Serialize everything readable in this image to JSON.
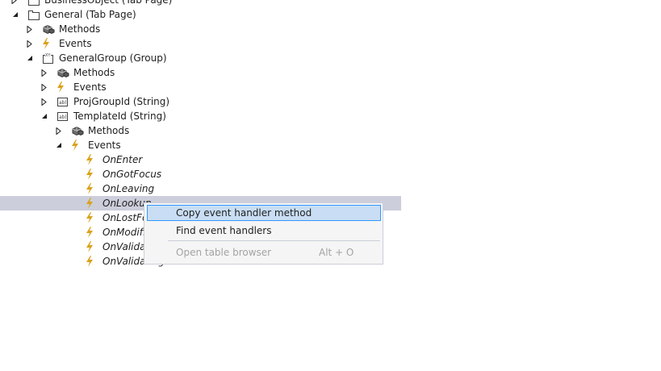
{
  "tree": [
    {
      "label": "BusinessObject (Tab Page)",
      "icon": "tab-page-icon",
      "expand": "collapsed",
      "italic": false
    },
    {
      "label": "General (Tab Page)",
      "icon": "tab-page-icon",
      "expand": "expanded",
      "italic": false
    },
    {
      "label": "Methods",
      "icon": "methods-icon",
      "expand": "collapsed",
      "italic": false
    },
    {
      "label": "Events",
      "icon": "events-icon",
      "expand": "collapsed",
      "italic": false
    },
    {
      "label": "GeneralGroup (Group)",
      "icon": "group-icon",
      "expand": "expanded",
      "italic": false
    },
    {
      "label": "Methods",
      "icon": "methods-icon",
      "expand": "collapsed",
      "italic": false
    },
    {
      "label": "Events",
      "icon": "events-icon",
      "expand": "collapsed",
      "italic": false
    },
    {
      "label": "ProjGroupId (String)",
      "icon": "string-field-icon",
      "expand": "collapsed",
      "italic": false
    },
    {
      "label": "TemplateId (String)",
      "icon": "string-field-icon",
      "expand": "expanded",
      "italic": false
    },
    {
      "label": "Methods",
      "icon": "methods-icon",
      "expand": "collapsed",
      "italic": false
    },
    {
      "label": "Events",
      "icon": "events-icon",
      "expand": "expanded",
      "italic": false
    },
    {
      "label": "OnEnter",
      "icon": "event-icon",
      "expand": "none",
      "italic": true
    },
    {
      "label": "OnGotFocus",
      "icon": "event-icon",
      "expand": "none",
      "italic": true
    },
    {
      "label": "OnLeaving",
      "icon": "event-icon",
      "expand": "none",
      "italic": true
    },
    {
      "label": "OnLookup",
      "icon": "event-icon",
      "expand": "none",
      "italic": true,
      "selected": true
    },
    {
      "label": "OnLostFocus",
      "icon": "event-icon",
      "expand": "none",
      "italic": true
    },
    {
      "label": "OnModified",
      "icon": "event-icon",
      "expand": "none",
      "italic": true
    },
    {
      "label": "OnValidated",
      "icon": "event-icon",
      "expand": "none",
      "italic": true
    },
    {
      "label": "OnValidating",
      "icon": "event-icon",
      "expand": "none",
      "italic": true
    }
  ],
  "context_menu": {
    "items": [
      {
        "label": "Copy event handler method",
        "state": "highlighted",
        "shortcut": ""
      },
      {
        "label": "Find event handlers",
        "state": "normal",
        "shortcut": ""
      },
      {
        "label": "Open table browser",
        "state": "disabled",
        "shortcut": "Alt + O"
      }
    ]
  },
  "colors": {
    "selection": "#cccedb",
    "menu_highlight": "#c9def5",
    "menu_highlight_border": "#3399ff",
    "event_bolt": "#d9a21b",
    "disabled_text": "#a2a4a5"
  }
}
